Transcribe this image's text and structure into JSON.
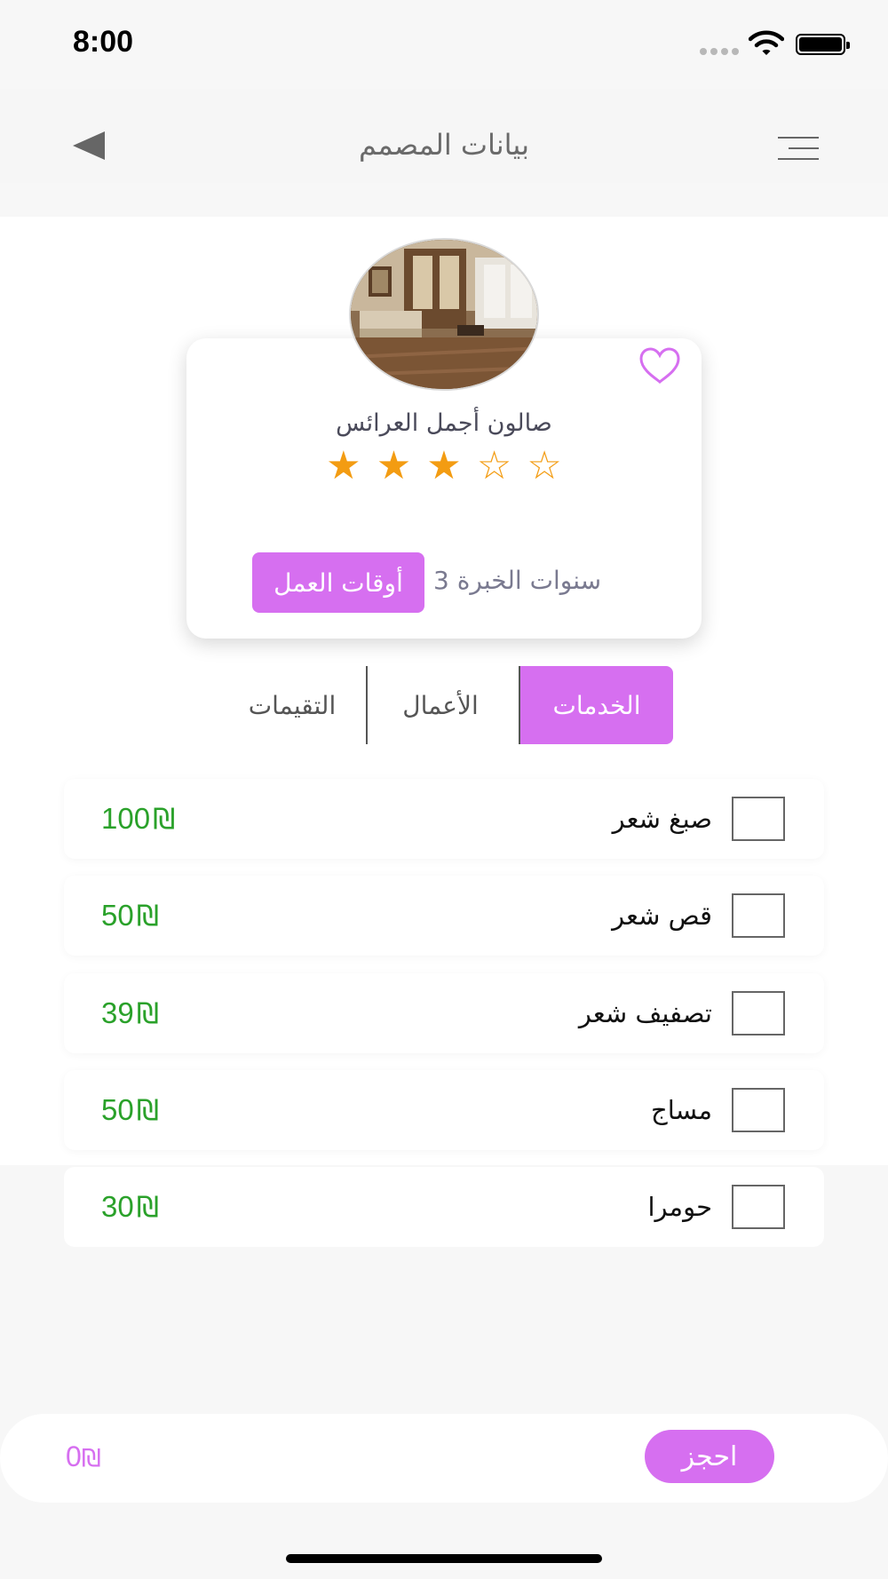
{
  "status_bar": {
    "time": "8:00",
    "icons": [
      "signal-icon",
      "wifi-icon",
      "battery-icon"
    ]
  },
  "nav": {
    "title": "بيانات المصمم",
    "back_icon": "back-arrow-icon",
    "menu_icon": "menu-icon"
  },
  "profile": {
    "name": "صالون أجمل العرائس",
    "rating": 3,
    "rating_max": 5,
    "stars": [
      "★",
      "★",
      "★",
      "☆",
      "☆"
    ],
    "experience_label": "سنوات الخبرة",
    "experience_years": "3",
    "hours_button_label": "أوقات العمل",
    "favorite_icon": "heart-icon"
  },
  "tabs": [
    {
      "label": "الخدمات",
      "active": true
    },
    {
      "label": "الأعمال",
      "active": false
    },
    {
      "label": "التقيمات",
      "active": false
    }
  ],
  "currency_symbol": "₪",
  "services": [
    {
      "name": "صبغ شعر",
      "price": "100",
      "checked": false
    },
    {
      "name": "قص شعر",
      "price": "50",
      "checked": false
    },
    {
      "name": "تصفيف شعر",
      "price": "39",
      "checked": false
    },
    {
      "name": "مساج",
      "price": "50",
      "checked": false
    },
    {
      "name": "حومرا",
      "price": "30",
      "checked": false
    }
  ],
  "booking": {
    "total": "0",
    "book_label": "احجز"
  },
  "colors": {
    "accent": "#d66ff0",
    "price": "#2aa12a",
    "star": "#f39c12"
  }
}
